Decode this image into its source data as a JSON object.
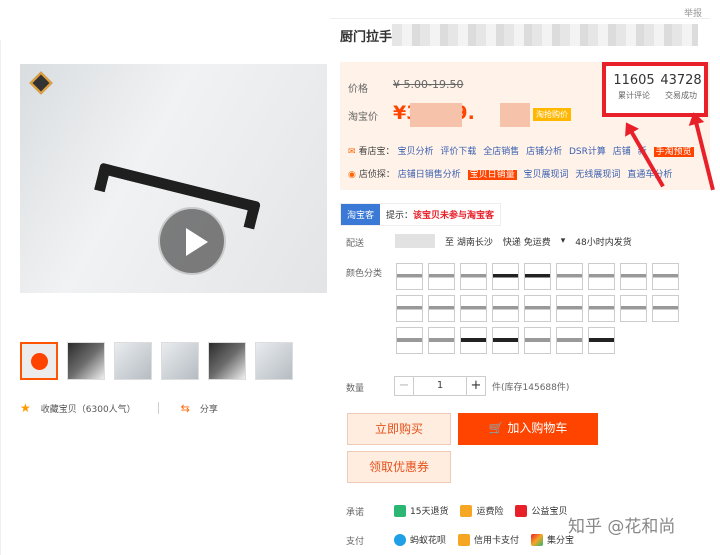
{
  "report": "举报",
  "title": "厨门拉手",
  "price": {
    "label_price": "价格",
    "original": "¥ 5.00-19.50",
    "label_taobao": "淘宝价",
    "current": "¥3.    -19.",
    "tag": "淘抢购价"
  },
  "tools": {
    "row1_label": "看店宝：",
    "row1_links": [
      "宝贝分析",
      "评价下载",
      "全店销售",
      "店铺分析",
      "DSR计算",
      "店铺",
      "新"
    ],
    "row1_highlight": "手淘预览",
    "row2_label": "店侦探：",
    "row2_links": [
      "店铺日销售分析"
    ],
    "row2_highlight": "宝贝日销量",
    "row2_links_after": [
      "宝贝展现词",
      "无线展现词",
      "直通车分析"
    ]
  },
  "stats": {
    "reviews_count": "11605",
    "reviews_label": "累计评论",
    "deals_count": "43728",
    "deals_label": "交易成功"
  },
  "ticket": {
    "badge": "淘宝客",
    "hint": "提示：",
    "notice": "该宝贝未参与淘宝客"
  },
  "delivery": {
    "label": "配送",
    "to": "至 湖南长沙",
    "fee": "快递 免运费",
    "ship": "48小时内发货"
  },
  "color_label": "颜色分类",
  "quantity": {
    "label": "数量",
    "minus": "−",
    "value": "1",
    "plus": "+",
    "stock": "件(库存145688件)"
  },
  "buttons": {
    "buy": "立即购买",
    "cart": "加入购物车",
    "coupon": "领取优惠券"
  },
  "promise": {
    "label": "承诺",
    "items": [
      "15天退货",
      "运费险",
      "公益宝贝"
    ]
  },
  "payment": {
    "label": "支付",
    "items": [
      "蚂蚁花呗",
      "信用卡支付",
      "集分宝"
    ]
  },
  "left": {
    "favorite": "收藏宝贝（6300人气）",
    "share": "分享"
  },
  "watermark": "知乎 @花和尚",
  "colors": {
    "accent": "#ff4400",
    "highlight_box": "#e8202a",
    "price_bg": "#fff2e8"
  }
}
